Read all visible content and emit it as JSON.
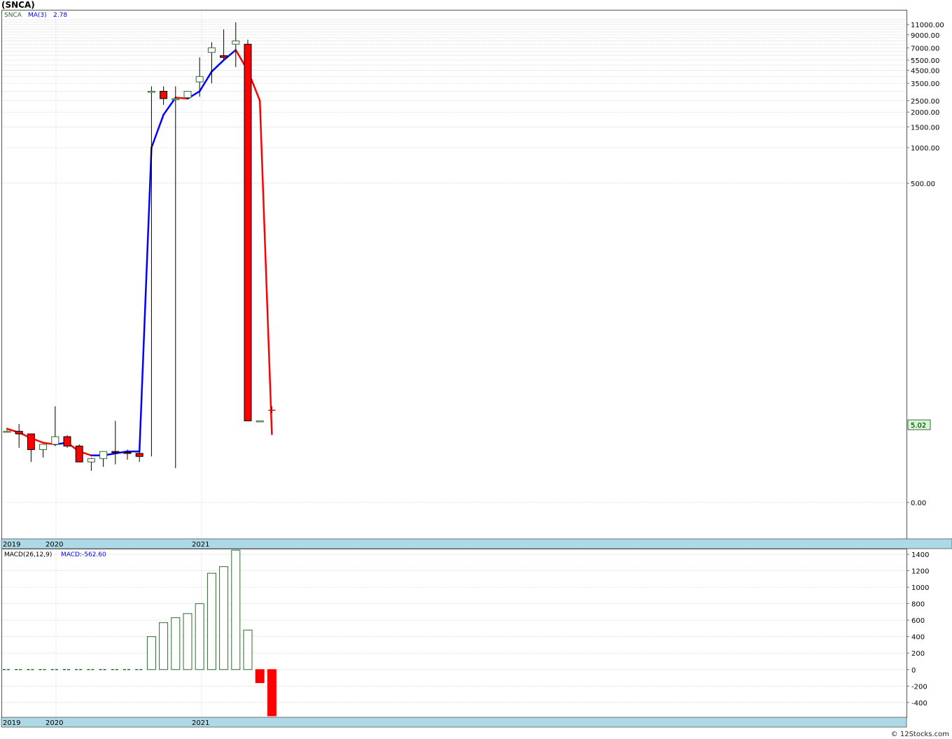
{
  "header": {
    "title": "(SNCA)"
  },
  "footer": {
    "credit": "© 12Stocks.com"
  },
  "price_panel": {
    "label": "SNCA",
    "ma_label": "MA(3)",
    "ma_value": "2.78",
    "current_price_label": "5.02",
    "y_tick_labels": [
      "11000.00",
      "9000.00",
      "7000.00",
      "5500.00",
      "4500.00",
      "3500.00",
      "2500.00",
      "2000.00",
      "1500.00",
      "1000.00",
      "500.00",
      "0.00"
    ],
    "x_tick_labels": [
      "2019",
      "2020",
      "2021"
    ]
  },
  "macd_panel": {
    "label": "MACD(26,12,9)",
    "value_label": "MACD:-562.60",
    "y_tick_labels": [
      "1400",
      "1200",
      "1000",
      "800",
      "600",
      "400",
      "200",
      "0",
      "-200",
      "-400"
    ],
    "x_tick_labels": [
      "2019",
      "2020",
      "2021"
    ]
  },
  "colors": {
    "up_candle": "#2e6b2e",
    "down_candle": "#ff0000",
    "ma_up": "#0000ff",
    "ma_down": "#ff0000",
    "axis_band": "#add8e6",
    "grid": "#c8c8c8",
    "price_tag_bg": "#ccffcc"
  },
  "chart_data": [
    {
      "type": "candlestick",
      "title": "(SNCA)",
      "ylabel": "",
      "scale": "log",
      "series_name": "SNCA",
      "x": [
        "2019-11",
        "2019-12",
        "2020-01",
        "2020-02",
        "2020-03",
        "2020-04",
        "2020-05",
        "2020-06",
        "2020-07",
        "2020-08",
        "2020-09",
        "2020-10",
        "2020-11",
        "2020-12",
        "2021-01",
        "2021-02",
        "2021-03",
        "2021-04",
        "2021-05",
        "2021-06",
        "2021-07",
        "2021-08",
        "2021-09"
      ],
      "open": [
        3.0,
        3.0,
        2.8,
        1.8,
        2.1,
        2.6,
        2.0,
        1.2,
        1.35,
        1.7,
        1.65,
        1.6,
        3000,
        3000,
        2600,
        2650,
        3600,
        6400,
        6000,
        7500,
        7500,
        3.9,
        null
      ],
      "high": [
        3.1,
        3.6,
        2.8,
        2.0,
        5.5,
        2.7,
        2.1,
        1.4,
        1.7,
        3.9,
        1.8,
        1.8,
        3300,
        3300,
        3300,
        3000,
        5800,
        7800,
        10000,
        11500,
        8200,
        3.9,
        5.5
      ],
      "low": [
        2.9,
        1.9,
        1.2,
        1.4,
        2.0,
        1.9,
        1.6,
        0.85,
        1.0,
        1.1,
        1.3,
        1.2,
        1.45,
        2300,
        0.95,
        2600,
        2700,
        3500,
        5500,
        4800,
        3.9,
        3.85,
        4.7
      ],
      "close": [
        3.0,
        2.8,
        1.8,
        2.1,
        2.6,
        2.0,
        1.2,
        1.35,
        1.7,
        1.65,
        1.6,
        1.45,
        3000,
        2600,
        2600,
        3000,
        4000,
        7000,
        5800,
        8000,
        3.9,
        3.9,
        5.02
      ],
      "ma_label": "MA(3)",
      "ma_last": 2.78,
      "ma": [
        3.2,
        2.9,
        2.5,
        2.2,
        2.1,
        2.2,
        1.7,
        1.5,
        1.5,
        1.6,
        1.7,
        1.7,
        1000,
        1900,
        2650,
        2600,
        3000,
        4400,
        5500,
        6700,
        4500,
        2500,
        2.78
      ],
      "yticks": [
        0,
        500,
        1000,
        1500,
        2000,
        2500,
        3500,
        4500,
        5500,
        7000,
        9000,
        11000
      ],
      "current_price": 5.02
    },
    {
      "type": "bar",
      "title": "MACD(26,12,9)",
      "value_label": "MACD:-562.60",
      "x": [
        "2019-11",
        "2019-12",
        "2020-01",
        "2020-02",
        "2020-03",
        "2020-04",
        "2020-05",
        "2020-06",
        "2020-07",
        "2020-08",
        "2020-09",
        "2020-10",
        "2020-11",
        "2020-12",
        "2021-01",
        "2021-02",
        "2021-03",
        "2021-04",
        "2021-05",
        "2021-06",
        "2021-07",
        "2021-08",
        "2021-09"
      ],
      "values": [
        0,
        0,
        0,
        0,
        0,
        0,
        0,
        0,
        0,
        0,
        0,
        0,
        400,
        570,
        630,
        680,
        800,
        1170,
        1250,
        1450,
        480,
        -160,
        -562.6
      ],
      "ylim": [
        -580,
        1460
      ],
      "yticks": [
        -400,
        -200,
        0,
        200,
        400,
        600,
        800,
        1000,
        1200,
        1400
      ]
    }
  ]
}
